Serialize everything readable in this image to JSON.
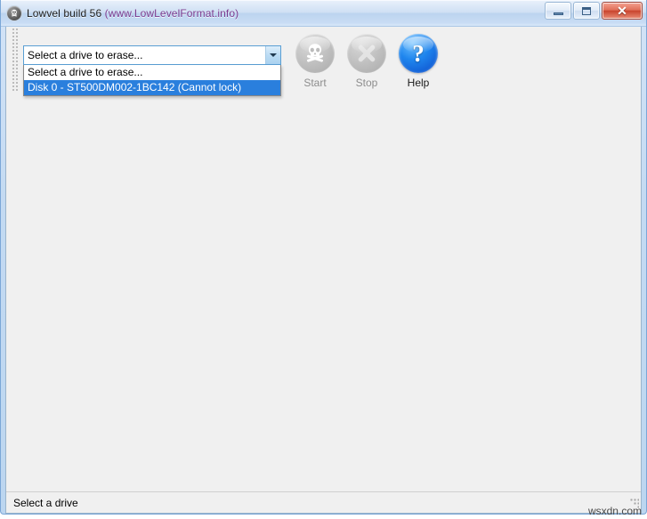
{
  "window": {
    "title_app": "Lowvel build 56 ",
    "title_url": "(www.LowLevelFormat.info)",
    "icon": "skull-app-icon",
    "controls": {
      "minimize_label": "Minimize",
      "maximize_label": "Maximize",
      "close_label": "✕"
    }
  },
  "toolbar": {
    "combo": {
      "value": "Select a drive to erase...",
      "expanded": true,
      "items": [
        {
          "label": "Select a drive to erase...",
          "selected": false
        },
        {
          "label": "Disk 0 - ST500DM002-1BC142 (Cannot lock)",
          "selected": true
        }
      ]
    },
    "buttons": [
      {
        "id": "start",
        "label": "Start",
        "icon": "skull-and-crossbones-icon",
        "enabled": false
      },
      {
        "id": "stop",
        "label": "Stop",
        "icon": "cross-x-icon",
        "enabled": false
      },
      {
        "id": "help",
        "label": "Help",
        "icon": "question-mark-icon",
        "enabled": true
      }
    ]
  },
  "status": {
    "text": "Select a drive"
  },
  "watermark": {
    "text": "wsxdn.com"
  },
  "colors": {
    "accent_blue": "#2a7fdd",
    "help_blue": "#1f86ee",
    "close_red": "#c9452f",
    "client_bg": "#f0f0f0",
    "title_url_purple": "#7a3b8f"
  }
}
